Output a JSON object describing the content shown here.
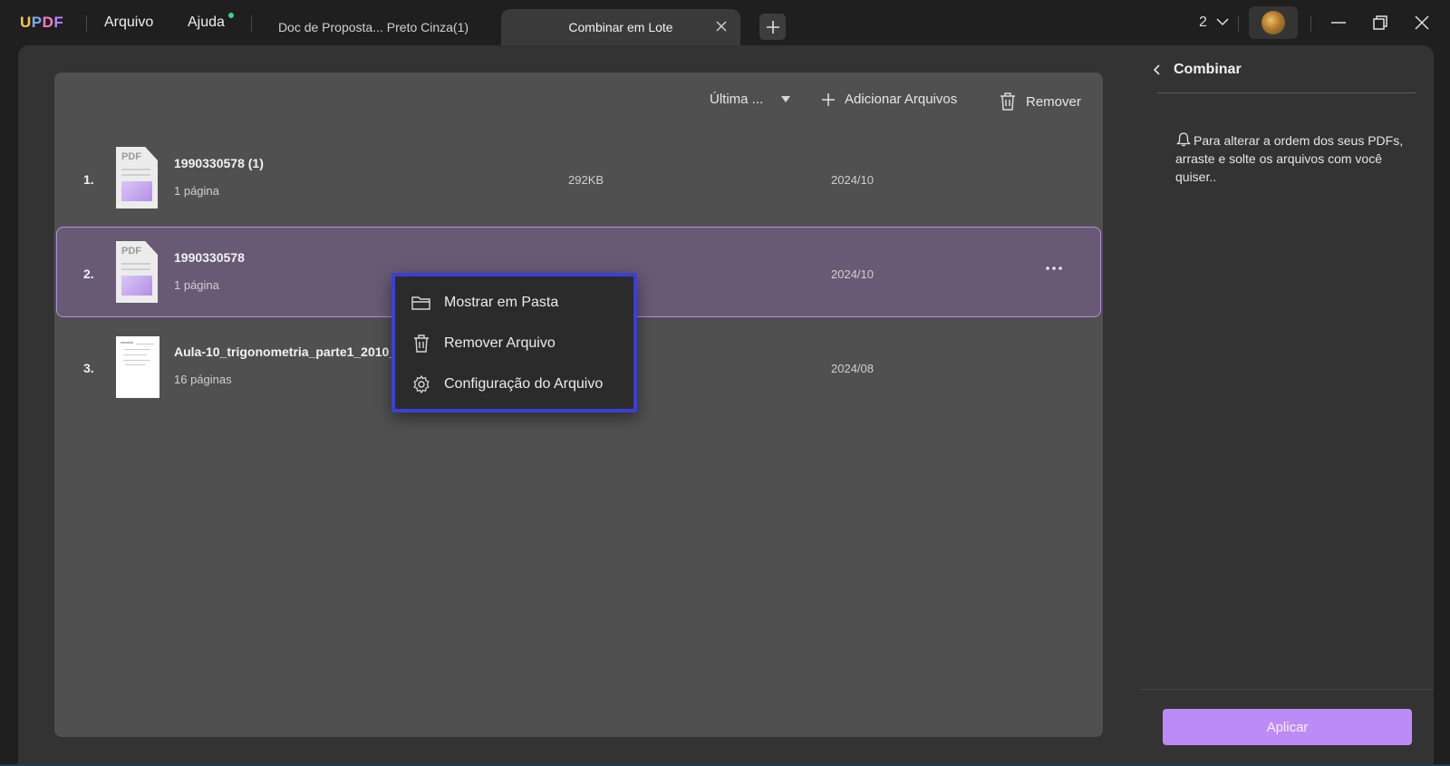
{
  "app": {
    "logo": "UPDF",
    "menu": {
      "file": "Arquivo",
      "help": "Ajuda"
    }
  },
  "tabs": [
    {
      "label": "Doc de Proposta... Preto Cinza(1)"
    },
    {
      "label": "Combinar em Lote"
    }
  ],
  "window": {
    "count": "2"
  },
  "toolbar": {
    "sort_label": "Última ...",
    "add_files_label": "Adicionar Arquivos",
    "remove_label": "Remover"
  },
  "files": [
    {
      "index": "1.",
      "name": "1990330578 (1)",
      "pages": "1 página",
      "size": "292KB",
      "date": "2024/10",
      "thumb": "PDF"
    },
    {
      "index": "2.",
      "name": "1990330578",
      "pages": "1 página",
      "size": "",
      "date": "2024/10",
      "thumb": "PDF"
    },
    {
      "index": "3.",
      "name": "Aula-10_trigonometria_parte1_2010_",
      "pages": "16 páginas",
      "size": "",
      "date": "2024/08",
      "thumb": ""
    }
  ],
  "context_menu": {
    "show_in_folder": "Mostrar em Pasta",
    "remove_file": "Remover Arquivo",
    "file_settings": "Configuração do Arquivo"
  },
  "right_panel": {
    "title": "Combinar",
    "tip": "Para alterar a ordem dos seus PDFs, arraste e solte os arquivos com você quiser..",
    "apply_label": "Aplicar"
  },
  "colors": {
    "accent": "#bd8bf7",
    "selected_row": "#685a75",
    "selected_border": "#b98ce6",
    "context_border": "#3d3fcf"
  }
}
